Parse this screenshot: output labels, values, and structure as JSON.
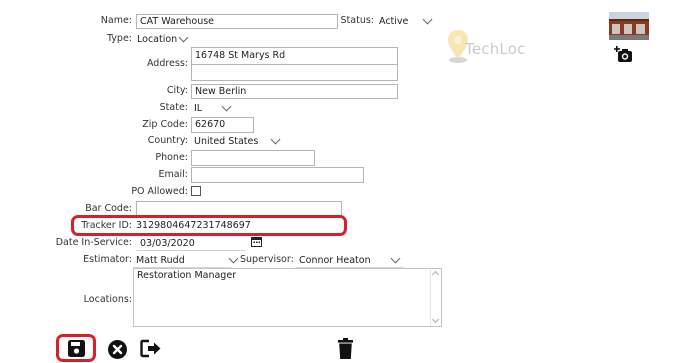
{
  "form": {
    "name": {
      "label": "Name:",
      "value": "CAT Warehouse"
    },
    "status": {
      "label": "Status:",
      "value": "Active"
    },
    "type": {
      "label": "Type:",
      "value": "Location"
    },
    "address": {
      "label": "Address:",
      "line1": "16748 St Marys Rd",
      "line2": ""
    },
    "city": {
      "label": "City:",
      "value": "New Berlin"
    },
    "state": {
      "label": "State:",
      "value": "IL"
    },
    "zip": {
      "label": "Zip Code:",
      "value": "62670"
    },
    "country": {
      "label": "Country:",
      "value": "United States"
    },
    "phone": {
      "label": "Phone:",
      "value": ""
    },
    "email": {
      "label": "Email:",
      "value": ""
    },
    "po_allowed": {
      "label": "PO Allowed:",
      "checked": false
    },
    "bar_code": {
      "label": "Bar Code:",
      "value": ""
    },
    "tracker_id": {
      "label": "Tracker ID:",
      "value": "3129804647231748697"
    },
    "date_in_service": {
      "label": "Date In-Service:",
      "value": "03/03/2020"
    },
    "estimator": {
      "label": "Estimator:",
      "value": "Matt Rudd"
    },
    "supervisor": {
      "label": "Supervisor:",
      "value": "Connor Heaton"
    },
    "locations": {
      "label": "Locations:",
      "items": [
        "Restoration Manager"
      ]
    }
  },
  "logo": {
    "text": "TechLoc"
  },
  "icons": {
    "photo": "building-photo",
    "add_photo": "add-camera-icon",
    "calendar": "calendar-icon",
    "save": "save-icon",
    "cancel": "cancel-icon",
    "exit": "exit-icon",
    "delete": "trash-icon"
  },
  "colors": {
    "highlight": "#d9202a",
    "icon": "#111111"
  }
}
